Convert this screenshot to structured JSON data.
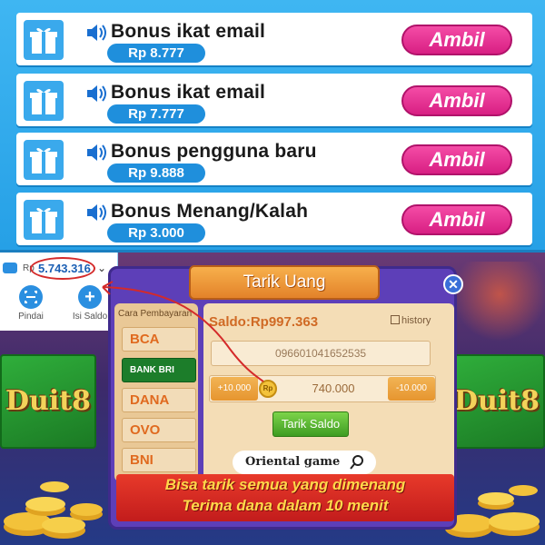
{
  "bonus_list": [
    {
      "title": "Bonus ikat email",
      "amount": "Rp 8.777",
      "button": "Ambil"
    },
    {
      "title": "Bonus ikat email",
      "amount": "Rp 7.777",
      "button": "Ambil"
    },
    {
      "title": "Bonus pengguna baru",
      "amount": "Rp 9.888",
      "button": "Ambil"
    },
    {
      "title": "Bonus Menang/Kalah",
      "amount": "Rp 3.000",
      "button": "Ambil"
    }
  ],
  "wallet": {
    "currency": "Rp",
    "balance": "5.743.316",
    "scan_label": "Pindai",
    "topup_label": "Isi Saldo"
  },
  "game_cards": {
    "left_logo": "Duit8",
    "right_logo": "Duit8"
  },
  "withdraw": {
    "title": "Tarik Uang",
    "method_header": "Cara Pembayaran",
    "methods": [
      "BCA",
      "BANK BRI",
      "DANA",
      "OVO",
      "BNI"
    ],
    "saldo": "Saldo:Rp997.363",
    "history_label": "history",
    "account_number": "096601041652535",
    "step_plus": "+10.000",
    "step_minus": "-10.000",
    "coin_badge": "Rp",
    "amount": "740.000",
    "submit_label": "Tarik Saldo",
    "brand": "Oriental game",
    "promo_line1": "Bisa tarik semua yang dimenang",
    "promo_line2": "Terima dana dalam 10 menit"
  },
  "colors": {
    "panel_blue": "#2a9fe0",
    "ambil_pink": "#e22a8f",
    "amount_blue": "#1f8fdc",
    "annotation_red": "#d42a2a",
    "dialog_purple": "#5d3fb8"
  },
  "icons": [
    "gift-icon",
    "speaker-icon",
    "wallet-icon",
    "chevron-down-icon",
    "scan-icon",
    "plus-icon",
    "close-icon",
    "search-icon",
    "history-icon",
    "coin-icon"
  ]
}
